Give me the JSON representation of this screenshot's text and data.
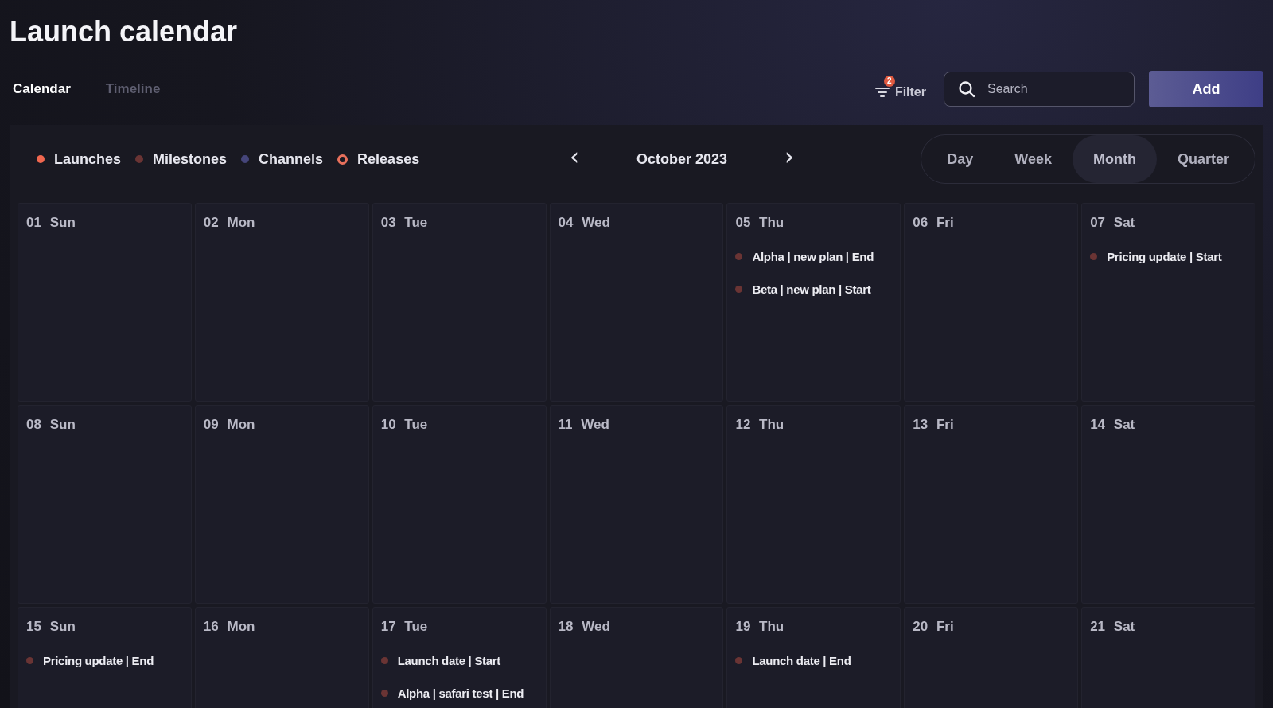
{
  "title": "Launch calendar",
  "tabs": [
    {
      "label": "Calendar",
      "selected": true
    },
    {
      "label": "Timeline",
      "selected": false
    }
  ],
  "filter": {
    "label": "Filter",
    "badge": "2"
  },
  "search": {
    "placeholder": "Search"
  },
  "add_button": "Add",
  "legend": [
    {
      "label": "Launches",
      "kind": "dot",
      "color": "#f0674f"
    },
    {
      "label": "Milestones",
      "kind": "dot",
      "color": "#6a3434"
    },
    {
      "label": "Channels",
      "kind": "dot",
      "color": "#45457a"
    },
    {
      "label": "Releases",
      "kind": "ring",
      "color": "#e8705c"
    }
  ],
  "month": {
    "previous": "‹",
    "label": "October 2023",
    "next": "›"
  },
  "views": [
    {
      "label": "Day",
      "selected": false
    },
    {
      "label": "Week",
      "selected": false
    },
    {
      "label": "Month",
      "selected": true
    },
    {
      "label": "Quarter",
      "selected": false
    }
  ],
  "weeks": [
    [
      {
        "date": "01",
        "weekday": "Sun"
      },
      {
        "date": "02",
        "weekday": "Mon"
      },
      {
        "date": "03",
        "weekday": "Tue"
      },
      {
        "date": "04",
        "weekday": "Wed"
      },
      {
        "date": "05",
        "weekday": "Thu",
        "events": [
          {
            "label": "Alpha | new plan | End",
            "color": "#6a3434"
          },
          {
            "label": "Beta | new plan | Start",
            "color": "#6a3434"
          }
        ]
      },
      {
        "date": "06",
        "weekday": "Fri"
      },
      {
        "date": "07",
        "weekday": "Sat",
        "events": [
          {
            "label": "Pricing update | Start",
            "color": "#6a3434"
          }
        ]
      }
    ],
    [
      {
        "date": "08",
        "weekday": "Sun"
      },
      {
        "date": "09",
        "weekday": "Mon"
      },
      {
        "date": "10",
        "weekday": "Tue"
      },
      {
        "date": "11",
        "weekday": "Wed"
      },
      {
        "date": "12",
        "weekday": "Thu"
      },
      {
        "date": "13",
        "weekday": "Fri"
      },
      {
        "date": "14",
        "weekday": "Sat"
      }
    ],
    [
      {
        "date": "15",
        "weekday": "Sun",
        "events": [
          {
            "label": "Pricing update | End",
            "color": "#6a3434"
          }
        ]
      },
      {
        "date": "16",
        "weekday": "Mon"
      },
      {
        "date": "17",
        "weekday": "Tue",
        "events": [
          {
            "label": "Launch date | Start",
            "color": "#6a3434"
          },
          {
            "label": "Alpha | safari test | End",
            "color": "#6a3434"
          }
        ]
      },
      {
        "date": "18",
        "weekday": "Wed"
      },
      {
        "date": "19",
        "weekday": "Thu",
        "events": [
          {
            "label": "Launch date | End",
            "color": "#6a3434"
          }
        ]
      },
      {
        "date": "20",
        "weekday": "Fri"
      },
      {
        "date": "21",
        "weekday": "Sat"
      }
    ]
  ]
}
